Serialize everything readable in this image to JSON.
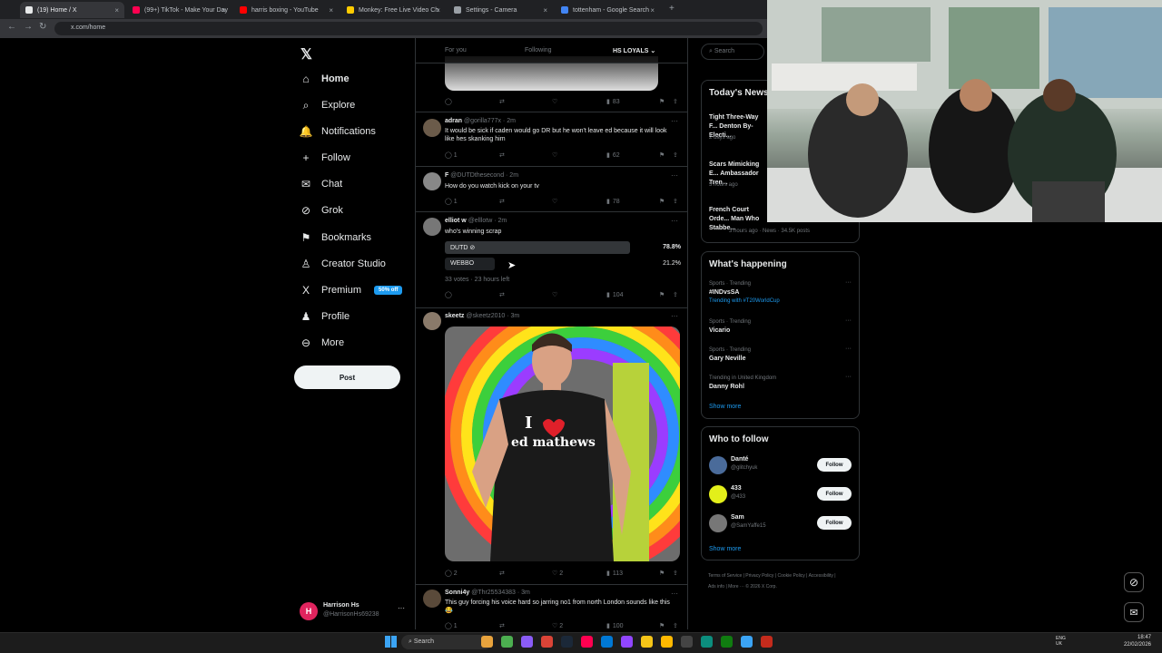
{
  "browser": {
    "tabs": [
      {
        "label": "(19) Home / X",
        "active": true,
        "color": "#e7e9ea"
      },
      {
        "label": "(99+) TikTok - Make Your Day",
        "active": false,
        "color": "#ff0050"
      },
      {
        "label": "harris boxing - YouTube",
        "active": false,
        "color": "#ff0000"
      },
      {
        "label": "Monkey: Free Live Video Ch",
        "active": false,
        "color": "#ffcc00"
      },
      {
        "label": "Settings - Camera",
        "active": false,
        "color": "#9aa0a6"
      },
      {
        "label": "tottenham - Google Search",
        "active": false,
        "color": "#4285f4"
      }
    ],
    "new_tab": "+",
    "url": "x.com/home"
  },
  "nav": {
    "items": [
      {
        "label": "Home",
        "icon": "home-icon",
        "glyph": "⌂"
      },
      {
        "label": "Explore",
        "icon": "search-icon",
        "glyph": "⌕"
      },
      {
        "label": "Notifications",
        "icon": "bell-icon",
        "glyph": "🔔"
      },
      {
        "label": "Follow",
        "icon": "person-add-icon",
        "glyph": "+"
      },
      {
        "label": "Chat",
        "icon": "mail-icon",
        "glyph": "✉"
      },
      {
        "label": "Grok",
        "icon": "grok-icon",
        "glyph": "⊘"
      },
      {
        "label": "Bookmarks",
        "icon": "bookmark-icon",
        "glyph": "⚑"
      },
      {
        "label": "Creator Studio",
        "icon": "creator-icon",
        "glyph": "♙"
      },
      {
        "label": "Premium",
        "icon": "x-icon",
        "glyph": "X"
      },
      {
        "label": "Profile",
        "icon": "profile-icon",
        "glyph": "♟"
      },
      {
        "label": "More",
        "icon": "more-icon",
        "glyph": "⊖"
      }
    ],
    "premium_badge": "50% off",
    "post_label": "Post",
    "account": {
      "name": "Harrison Hs",
      "handle": "@HarrisonHs69238",
      "initial": "H"
    }
  },
  "timeline": {
    "tabs": [
      "For you",
      "Following",
      "HS LOYALS"
    ],
    "tweets": [
      {
        "name": "",
        "handle": "",
        "text": "",
        "replies": "",
        "views": "83"
      },
      {
        "name": "adran",
        "handle": "@gorilla777x · 2m",
        "text": "It would be sick if caden would go DR but he won't leave ed because it will look like hes skanking him",
        "replies": "1",
        "views": "62"
      },
      {
        "name": "F",
        "handle": "@DUTDthesecond · 2m",
        "text": "How do you watch kick on your tv",
        "replies": "1",
        "views": "78"
      },
      {
        "name": "elliot w",
        "handle": "@elllotw · 2m",
        "text": "who's winning scrap",
        "replies": "",
        "views": "104",
        "poll": {
          "options": [
            {
              "label": "DUTD ⊘",
              "percent": "78.8%"
            },
            {
              "label": "WEBBO",
              "percent": "21.2%"
            }
          ],
          "meta": "33 votes · 23 hours left"
        }
      },
      {
        "name": "skeetz",
        "handle": "@skeetz2010 · 3m",
        "text": "",
        "replies": "2",
        "likes": "2",
        "views": "113",
        "image": {
          "shirt_line1": "I",
          "shirt_line2": "ed mathews"
        }
      },
      {
        "name": "Sonni4y",
        "handle": "@Thr25534383 · 3m",
        "text": "This guy forcing his voice hard so jarring no1 from north London sounds like this 😂",
        "replies": "1",
        "likes": "2",
        "views": "100"
      }
    ]
  },
  "right": {
    "search_placeholder": "Search",
    "news": {
      "title": "Today's News",
      "items": [
        {
          "headline": "Tight Three-Way F... Denton By-Electi...",
          "meta": "2 days ago"
        },
        {
          "headline": "Scars Mimicking E... Ambassador Tren...",
          "meta": "5 hours ago"
        },
        {
          "headline": "French Court Orde... Man Who Stabbe...",
          "meta": "3 hours ago · News · 34.5K posts"
        }
      ]
    },
    "happening": {
      "title": "What's happening",
      "trends": [
        {
          "category": "Sports · Trending",
          "name": "#INDvsSA",
          "sub": "Trending with #T20WorldCup"
        },
        {
          "category": "Sports · Trending",
          "name": "Vicario",
          "sub": ""
        },
        {
          "category": "Sports · Trending",
          "name": "Gary Neville",
          "sub": ""
        },
        {
          "category": "Trending in United Kingdom",
          "name": "Danny Rohl",
          "sub": ""
        }
      ],
      "show_more": "Show more"
    },
    "who_to_follow": {
      "title": "Who to follow",
      "users": [
        {
          "name": "Danté",
          "handle": "@glitchyuk"
        },
        {
          "name": "433",
          "handle": "@433"
        },
        {
          "name": "Sam",
          "handle": "@SamYaffe15"
        }
      ],
      "follow_label": "Follow",
      "show_more": "Show more"
    },
    "footer": "Terms of Service | Privacy Policy | Cookie Policy | Accessibility | Ads info | More ··· © 2026 X Corp."
  },
  "taskbar": {
    "search": "Search",
    "lang": "ENG UK",
    "time": "18:47",
    "date": "22/02/2026"
  }
}
